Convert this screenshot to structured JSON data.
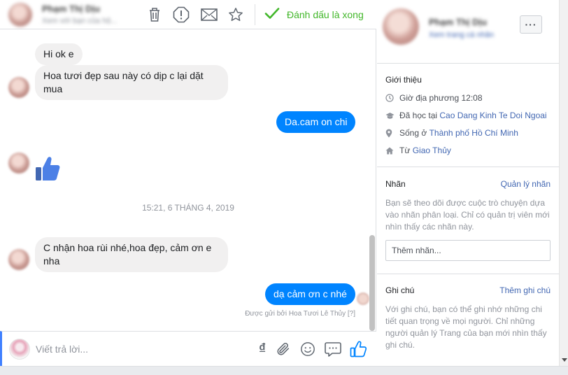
{
  "header": {
    "contact_name": "Phạm Thị Dịu",
    "contact_sub": "Xem với bạn của hộ...",
    "done_label": "Đánh dấu là xong",
    "icons": [
      "trash-icon",
      "alert-icon",
      "envelope-icon",
      "star-icon",
      "check-icon"
    ]
  },
  "messages": [
    {
      "side": "in",
      "text": "Hi ok e"
    },
    {
      "side": "in",
      "text": "Hoa tươi đẹp sau này có dịp c lại dặt mua"
    },
    {
      "side": "out",
      "text": "Da.cam on chi"
    },
    {
      "side": "in",
      "type": "like",
      "icon": "thumbs-up-icon"
    },
    {
      "side": "in",
      "text": "C nhận hoa rùi nhé,hoa đẹp, cảm ơn e nha"
    },
    {
      "side": "out",
      "text": "dạ cảm ơn c nhé"
    }
  ],
  "timestamp": "15:21, 6 THÁNG 4, 2019",
  "sent_by": "Được gửi bởi Hoa Tươi Lê Thủy",
  "sent_by_help": "[?]",
  "composer": {
    "placeholder": "Viết trả lời...",
    "currency_symbol": "₫",
    "icons": [
      "currency-icon",
      "attachment-icon",
      "emoji-icon",
      "saved-reply-icon",
      "thumbs-up-icon"
    ]
  },
  "info": {
    "name": "Phạm Thị Dịu",
    "profile_link": "Xem trang cá nhân",
    "more_label": "···",
    "intro": {
      "title": "Giới thiệu",
      "local_time": "Giờ địa phương 12:08",
      "studied_prefix": "Đã học tại",
      "studied_place": "Cao Dang Kinh Te Doi Ngoai",
      "lives_prefix": "Sống ở",
      "lives_place": "Thành phố Hồ Chí Minh",
      "from_prefix": "Từ",
      "from_place": "Giao Thủy"
    },
    "labels": {
      "title": "Nhãn",
      "action": "Quản lý nhãn",
      "description": "Bạn sẽ theo dõi được cuộc trò chuyện dựa vào nhãn phân loại. Chỉ có quản trị viên mới nhìn thấy các nhãn này.",
      "input_placeholder": "Thêm nhãn..."
    },
    "notes": {
      "title": "Ghi chú",
      "action": "Thêm ghi chú",
      "description": "Với ghi chú, bạn có thể ghi nhớ những chi tiết quan trọng về mọi người. Chỉ những người quản lý Trang của bạn mới nhìn thấy ghi chú."
    }
  },
  "colors": {
    "accent_blue": "#0084ff",
    "link_blue": "#4267b2",
    "done_green": "#42b72a",
    "incoming_bubble": "#f1f0f0"
  }
}
